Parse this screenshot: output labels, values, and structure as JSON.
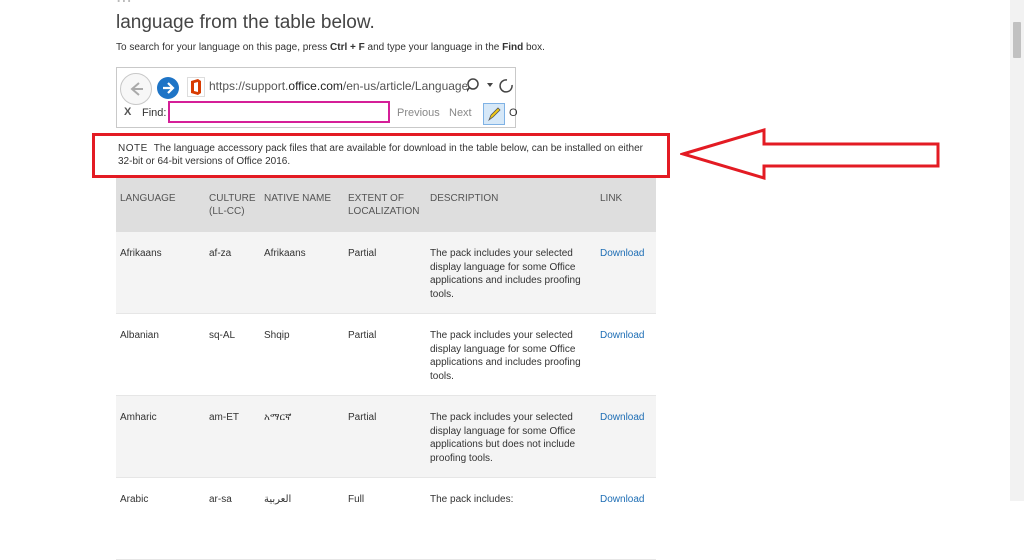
{
  "heading": {
    "line1": "...",
    "line2": "language from the table below."
  },
  "instruction": {
    "prefix": "To search for your language on this page, press ",
    "keys": "Ctrl + F",
    "middle": " and type your language in the ",
    "find_word": "Find",
    "suffix": " box."
  },
  "browser": {
    "url_prefix": "https://support.",
    "url_domain": "office.com",
    "url_suffix": "/en-us/article/Language-",
    "find_close": "X",
    "find_label": "Find:",
    "find_value": "",
    "previous_label": "Previous",
    "next_label": "Next",
    "option_glyph": "O"
  },
  "note": {
    "label": "NOTE",
    "text": "The language accessory pack files that are available for download in the table below, can be installed on either 32-bit or 64-bit versions of Office 2016."
  },
  "annotation": {
    "box_color": "#e31b23",
    "arrow_color": "#e31b23"
  },
  "table": {
    "headers": [
      "LANGUAGE",
      "CULTURE (LL-CC)",
      "NATIVE NAME",
      "EXTENT OF LOCALIZATION",
      "DESCRIPTION",
      "LINK"
    ],
    "rows": [
      {
        "language": "Afrikaans",
        "culture": "af-za",
        "native": "Afrikaans",
        "extent": "Partial",
        "description": "The pack includes your selected display language for some Office applications and includes proofing tools.",
        "link": "Download"
      },
      {
        "language": "Albanian",
        "culture": "sq-AL",
        "native": "Shqip",
        "extent": "Partial",
        "description": "The pack includes your selected display language for some Office applications and includes proofing tools.",
        "link": "Download"
      },
      {
        "language": "Amharic",
        "culture": "am-ET",
        "native": "አማርኛ",
        "extent": "Partial",
        "description": "The pack includes your selected display language for some Office applications but does not include proofing tools.",
        "link": "Download"
      },
      {
        "language": "Arabic",
        "culture": "ar-sa",
        "native": "العربية",
        "extent": "Full",
        "description": "The pack includes:",
        "link": "Download"
      }
    ]
  }
}
